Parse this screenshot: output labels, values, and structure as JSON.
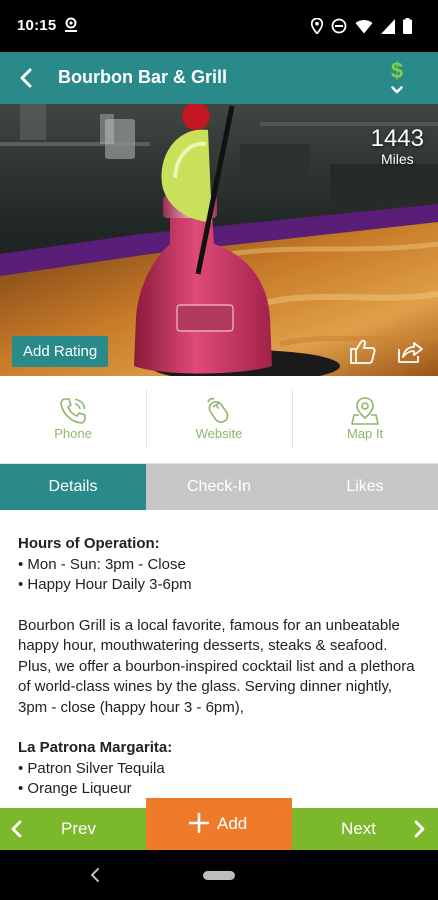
{
  "status_bar": {
    "time": "10:15",
    "left_icon": "location-badge-icon",
    "right_icons": [
      "location-icon",
      "do-not-disturb-icon",
      "wifi-icon",
      "signal-icon",
      "battery-icon"
    ]
  },
  "app_bar": {
    "title": "Bourbon Bar & Grill",
    "price_symbol": "$",
    "back_icon": "back-arrow-icon"
  },
  "hero": {
    "distance_value": "1443",
    "distance_unit": "Miles",
    "add_rating_label": "Add Rating",
    "like_icon": "thumbs-up-icon",
    "share_icon": "share-icon"
  },
  "actions": [
    {
      "label": "Phone",
      "icon": "phone-icon"
    },
    {
      "label": "Website",
      "icon": "mouse-icon"
    },
    {
      "label": "Map It",
      "icon": "map-pin-icon"
    }
  ],
  "tabs": [
    {
      "label": "Details",
      "active": true
    },
    {
      "label": "Check-In",
      "active": false
    },
    {
      "label": "Likes",
      "active": false
    }
  ],
  "details": {
    "hours_heading": "Hours of Operation:",
    "hours_lines": [
      "• Mon - Sun: 3pm - Close",
      "• Happy Hour Daily 3-6pm"
    ],
    "description": "Bourbon Grill is a local favorite, famous for an unbeatable happy hour, mouthwatering desserts, steaks & seafood. Plus, we offer a bourbon-inspired cocktail list and a plethora of world-class wines by the glass. Serving dinner nightly, 3pm - close (happy hour 3 - 6pm),",
    "special_heading": "La Patrona Margarita:",
    "special_lines": [
      "• Patron Silver Tequila",
      "• Orange Liqueur"
    ]
  },
  "bottom_nav": {
    "prev_label": "Prev",
    "add_label": "Add",
    "next_label": "Next"
  },
  "colors": {
    "teal": "#2a8a8a",
    "green": "#7cb82c",
    "orange": "#ee7a2a",
    "action_green": "#8fb569",
    "tab_inactive": "#c6c6c6"
  }
}
